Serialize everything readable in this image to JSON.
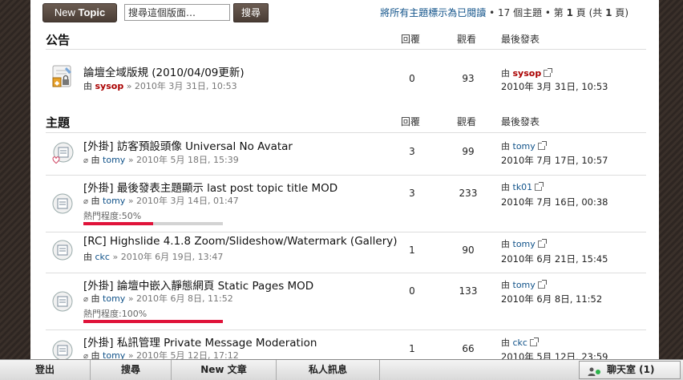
{
  "toolbar": {
    "new_topic_prefix": "New",
    "new_topic_label": "Topic",
    "search_placeholder": "搜尋這個版面…",
    "search_button": "搜尋",
    "mark_read_link": "將所有主題標示為已閱讀",
    "topics_count_text": "• 17 個主題 • 第",
    "page_current": "1",
    "page_suffix": "頁 (共",
    "page_total": "1",
    "page_end": "頁)"
  },
  "columns": {
    "replies": "回覆",
    "views": "觀看",
    "last_post": "最後發表"
  },
  "announcements": {
    "heading": "公告",
    "rows": [
      {
        "title": "論壇全域版規 (2010/04/09更新)",
        "by": "由",
        "author": "sysop",
        "date": "» 2010年 3月 31日, 10:53",
        "replies": "0",
        "views": "93",
        "last_by": "由",
        "last_user": "sysop",
        "last_date": "2010年 3月 31日, 10:53"
      }
    ]
  },
  "topics": {
    "heading": "主題",
    "rows": [
      {
        "title": "[外掛] 訪客預設頭像 Universal No Avatar",
        "by": "由",
        "author": "tomy",
        "date": "» 2010年 5月 18日, 15:39",
        "replies": "3",
        "views": "99",
        "last_by": "由",
        "last_user": "tomy",
        "last_date": "2010年 7月 17日, 10:57"
      },
      {
        "title": "[外掛] 最後發表主題顯示 last post topic title MOD",
        "by": "由",
        "author": "tomy",
        "date": "» 2010年 3月 14日, 01:47",
        "hot_label": "熱門程度:50%",
        "hot_value": 0.5,
        "replies": "3",
        "views": "233",
        "last_by": "由",
        "last_user": "tk01",
        "last_date": "2010年 7月 16日, 00:38"
      },
      {
        "title": "[RC] Highslide 4.1.8 Zoom/Slideshow/Watermark (Gallery)",
        "by": "由",
        "author": "ckc",
        "date": "» 2010年 6月 19日, 13:47",
        "replies": "1",
        "views": "90",
        "last_by": "由",
        "last_user": "tomy",
        "last_date": "2010年 6月 21日, 15:45"
      },
      {
        "title": "[外掛] 論壇中嵌入靜態網頁 Static Pages MOD",
        "by": "由",
        "author": "tomy",
        "date": "» 2010年 6月 8日, 11:52",
        "hot_label": "熱門程度:100%",
        "hot_value": 1.0,
        "replies": "0",
        "views": "133",
        "last_by": "由",
        "last_user": "tomy",
        "last_date": "2010年 6月 8日, 11:52"
      },
      {
        "title": "[外掛] 私訊管理 Private Message Moderation",
        "by": "由",
        "author": "tomy",
        "date": "» 2010年 5月 12日, 17:12",
        "replies": "1",
        "views": "66",
        "last_by": "由",
        "last_user": "ckc",
        "last_date": "2010年 5月 12日, 23:59"
      }
    ]
  },
  "bottom_nav": {
    "logout": "登出",
    "search": "搜尋",
    "new_posts_prefix": "New",
    "new_posts": "文章",
    "private_msgs": "私人訊息",
    "chat": "聊天室 (1)"
  },
  "colors": {
    "accent_red": "#e0133a",
    "link_blue": "#105289",
    "admin_red": "#aa0000"
  },
  "icons": [
    "announcement-lock-icon",
    "topic-read-icon",
    "topic-heart-icon",
    "paperclip-icon",
    "goto-last-post-icon",
    "users-online-icon"
  ]
}
